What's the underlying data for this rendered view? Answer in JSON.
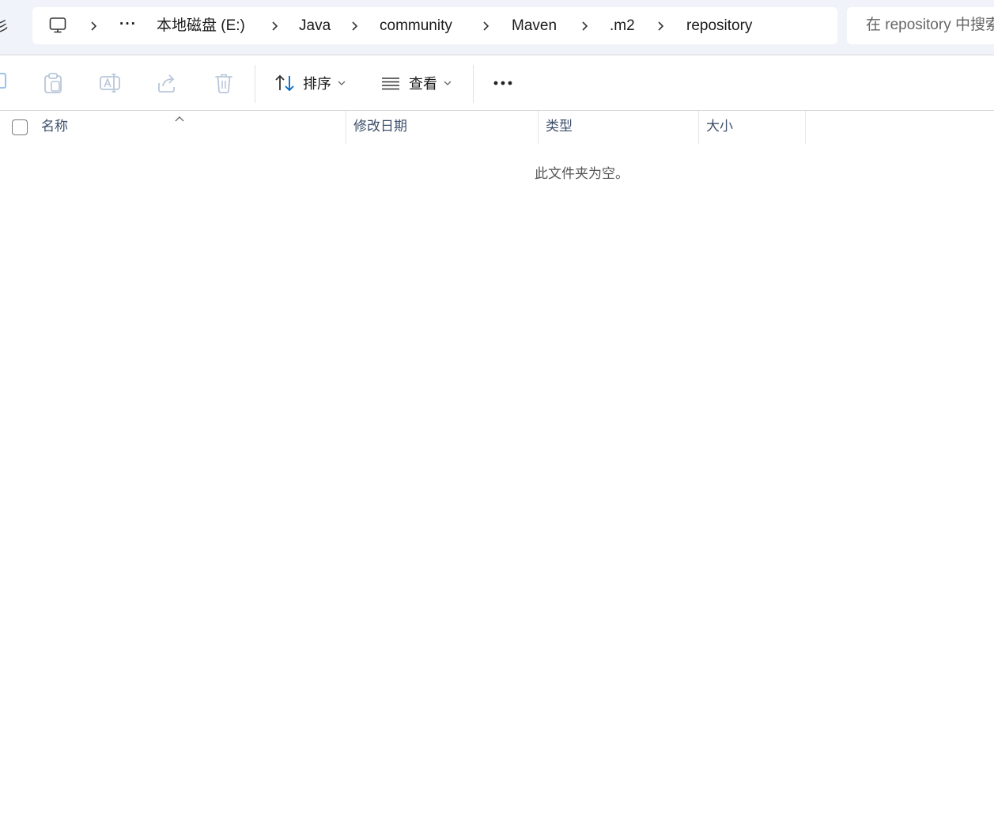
{
  "window": {
    "app": "File Explorer"
  },
  "address_bar": {
    "back_glyph": "彡",
    "this_pc_icon": "monitor-icon",
    "overflow_label": "···",
    "items": [
      {
        "label": "本地磁盘 (E:)"
      },
      {
        "label": "Java"
      },
      {
        "label": "community"
      },
      {
        "label": "Maven"
      },
      {
        "label": ".m2"
      },
      {
        "label": "repository"
      }
    ]
  },
  "search": {
    "placeholder": "在 repository 中搜索"
  },
  "toolbar": {
    "icons": [
      "copy-icon",
      "paste-icon",
      "rename-icon",
      "share-icon",
      "delete-icon"
    ],
    "sort_label": "排序",
    "view_label": "查看",
    "more_label": "···"
  },
  "columns": {
    "name": "名称",
    "modified": "修改日期",
    "type": "类型",
    "size": "大小",
    "sorted_by": "name"
  },
  "content": {
    "empty_message": "此文件夹为空。"
  },
  "colors": {
    "toolbar_bg": "#f0f3f9",
    "accent": "#0067c0",
    "header_text": "#3d4f6b",
    "disabled_icon": "#b9c7da"
  }
}
